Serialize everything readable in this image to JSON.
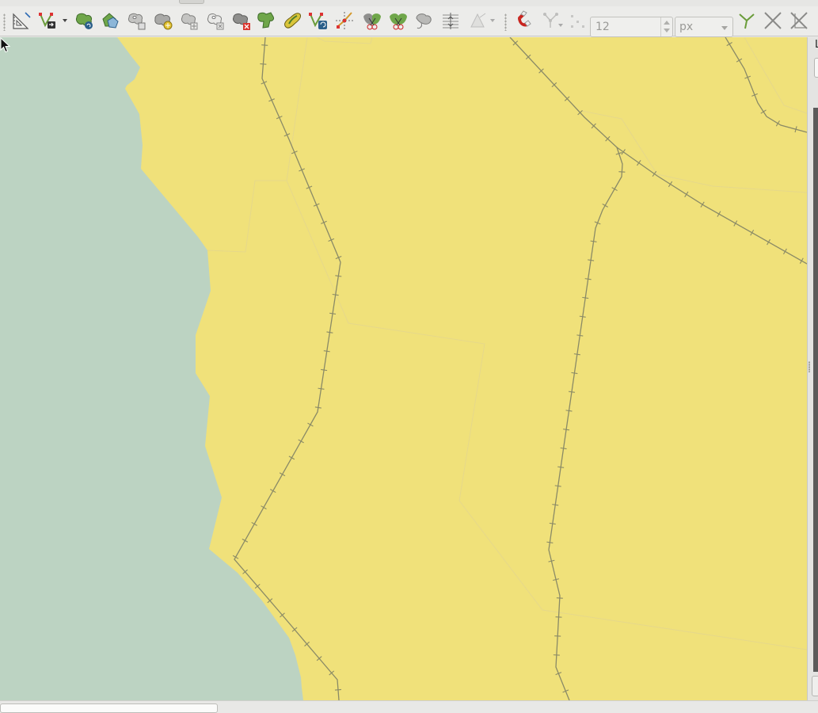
{
  "snapping_toolbar": {
    "tolerance_value": "12",
    "tolerance_unit": "px"
  },
  "layers_panel": {
    "title_fragment": "L"
  },
  "map_colors": {
    "land": "#f0e17a",
    "water": "#bcd3c2",
    "railway": "#8a8a66",
    "boundary": "#e6d88a"
  },
  "toolbar_icons": [
    "measure-icon",
    "vertex-tool-icon",
    "reshape-features-icon",
    "rotate-feature-icon",
    "simplify-feature-icon",
    "add-ring-icon",
    "add-part-icon",
    "fill-ring-icon",
    "delete-ring-icon",
    "delete-part-icon",
    "reshape-icon",
    "offset-curve-icon",
    "edit-vertex-icon",
    "split-features-icon",
    "split-parts-icon",
    "merge-features-icon",
    "merge-attributes-icon",
    "rotate-point-symbols-icon",
    "offset-point-symbol-icon",
    "snapping-magnet-icon",
    "snap-vertex-icon",
    "snap-segment-icon",
    "topological-editing-icon",
    "snap-intersection-icon",
    "avoid-overlap-icon"
  ]
}
